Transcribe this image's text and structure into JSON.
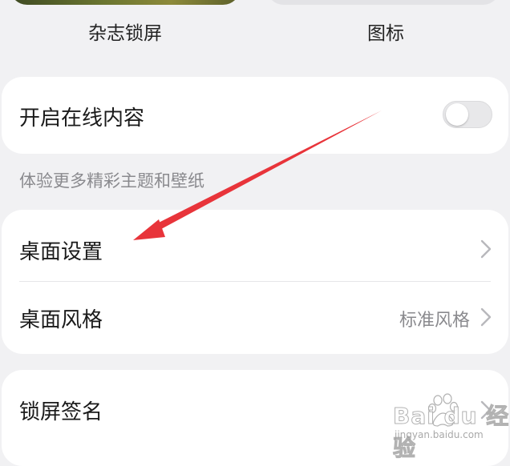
{
  "top_thumbnails": {
    "left_caption": "杂志锁屏",
    "right_caption": "图标"
  },
  "online_content": {
    "label": "开启在线内容",
    "enabled": false,
    "hint": "体验更多精彩主题和壁纸"
  },
  "desktop_group": {
    "items": [
      {
        "label": "桌面设置",
        "value": ""
      },
      {
        "label": "桌面风格",
        "value": "标准风格"
      }
    ]
  },
  "lock_group": {
    "items": [
      {
        "label": "锁屏签名"
      }
    ]
  },
  "annotation": {
    "arrow_color": "#e8343a"
  },
  "watermark": {
    "text": "Bai du 经验",
    "sub": "jingyan.baidu.com"
  },
  "icons": [
    "chevron-right-icon",
    "toggle-switch",
    "baidu-paw-icon"
  ]
}
